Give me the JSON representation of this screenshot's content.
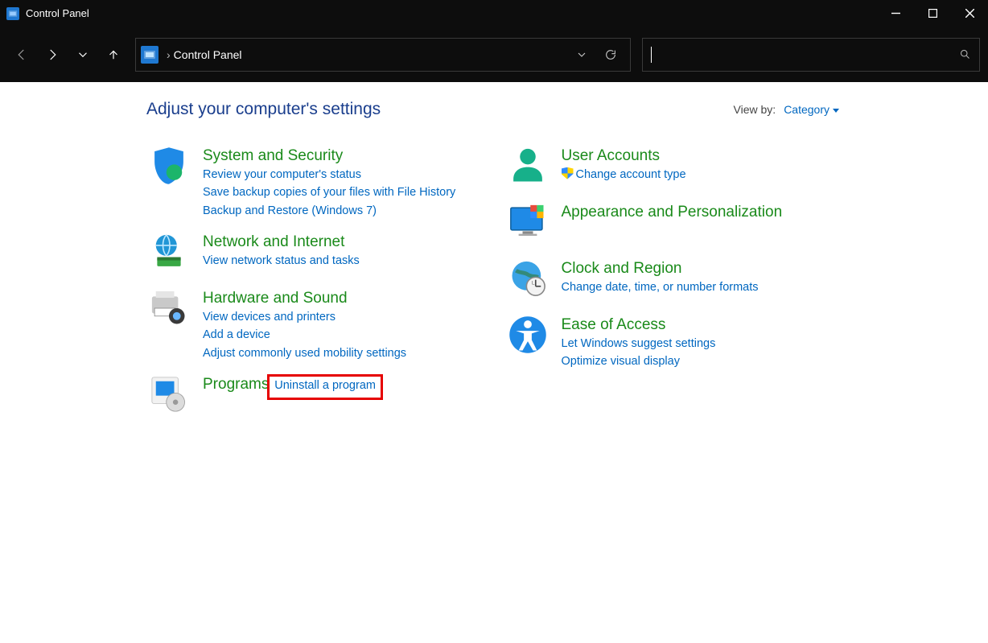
{
  "window": {
    "title": "Control Panel"
  },
  "breadcrumb": {
    "root": "Control Panel"
  },
  "header": {
    "heading": "Adjust your computer's settings",
    "viewby_label": "View by:",
    "viewby_value": "Category"
  },
  "left_categories": [
    {
      "id": "system-security",
      "title": "System and Security",
      "links": [
        "Review your computer's status",
        "Save backup copies of your files with File History",
        "Backup and Restore (Windows 7)"
      ]
    },
    {
      "id": "network-internet",
      "title": "Network and Internet",
      "links": [
        "View network status and tasks"
      ]
    },
    {
      "id": "hardware-sound",
      "title": "Hardware and Sound",
      "links": [
        "View devices and printers",
        "Add a device",
        "Adjust commonly used mobility settings"
      ]
    },
    {
      "id": "programs",
      "title": "Programs",
      "links": [
        "Uninstall a program"
      ]
    }
  ],
  "right_categories": [
    {
      "id": "user-accounts",
      "title": "User Accounts",
      "links": [
        "Change account type"
      ],
      "shield_on_first": true
    },
    {
      "id": "appearance",
      "title": "Appearance and Personalization",
      "links": []
    },
    {
      "id": "clock-region",
      "title": "Clock and Region",
      "links": [
        "Change date, time, or number formats"
      ]
    },
    {
      "id": "ease-of-access",
      "title": "Ease of Access",
      "links": [
        "Let Windows suggest settings",
        "Optimize visual display"
      ]
    }
  ]
}
